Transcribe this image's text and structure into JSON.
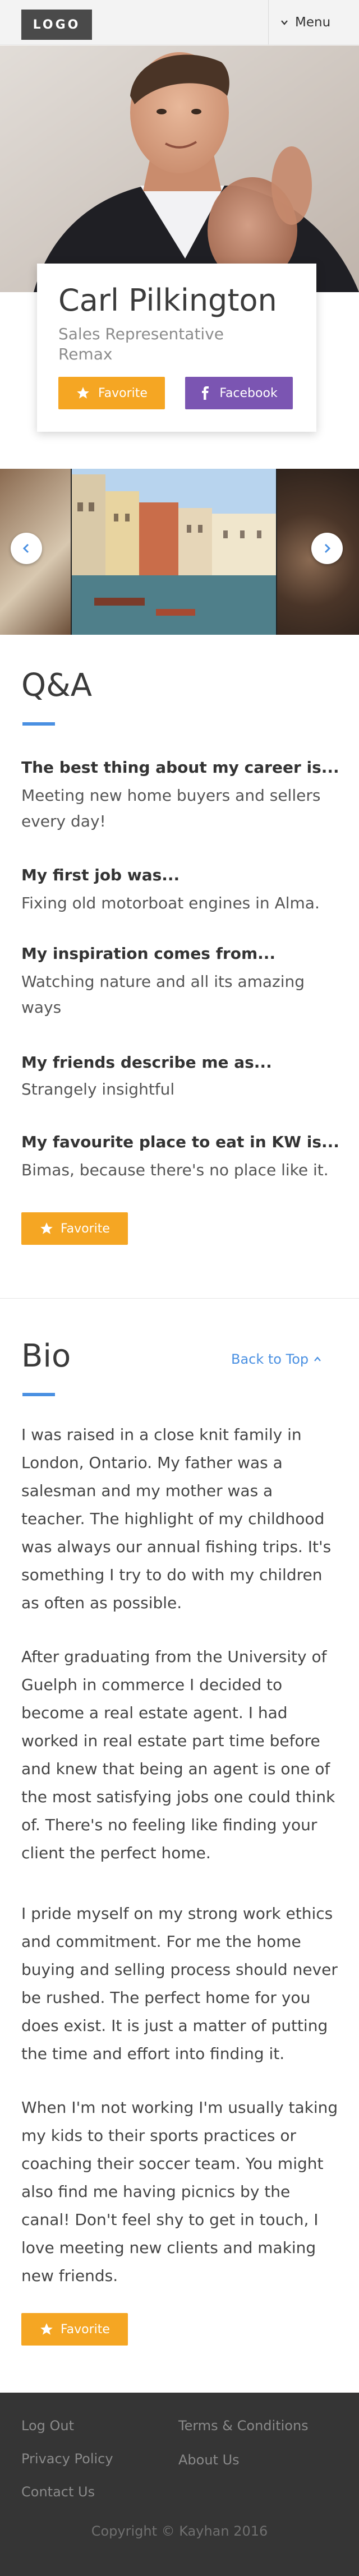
{
  "header": {
    "logo": "LOGO",
    "menu_label": "Menu"
  },
  "profile": {
    "name": "Carl Pilkington",
    "title": "Sales Representative",
    "company": "Remax",
    "favorite_label": "Favorite",
    "facebook_label": "Facebook"
  },
  "gallery": {
    "prev_icon": "chevron-left-icon",
    "next_icon": "chevron-right-icon"
  },
  "qa": {
    "title": "Q&A",
    "items": [
      {
        "question": "The best thing about my career is...",
        "answer": "Meeting new home buyers and sellers every day!"
      },
      {
        "question": "My first job was...",
        "answer": "Fixing old motorboat engines in Alma."
      },
      {
        "question": "My inspiration comes from...",
        "answer": "Watching nature and all its amazing ways"
      },
      {
        "question": "My friends describe me as...",
        "answer": "Strangely insightful"
      },
      {
        "question": "My favourite place to eat in KW is...",
        "answer": "Bimas, because there's no place like it."
      }
    ],
    "favorite_label": "Favorite"
  },
  "bio": {
    "title": "Bio",
    "back_to_top": "Back to Top",
    "paragraphs": [
      "I was raised in a close knit family in London, Ontario. My father was a salesman and my mother was a teacher. The highlight of my childhood was always our annual fishing trips. It's something I try to do with my children as often as possible.",
      "After graduating from the University of Guelph in commerce I decided to become a real estate agent. I had worked in real estate part time before and knew that being an agent is one of the most satisfying jobs one could think of. There's no feeling like finding your client the perfect home.",
      "I pride myself on my strong work ethics and commitment. For me the home buying and selling process should never be rushed. The perfect home for you does exist. It is just a matter of putting the time and effort into finding it.",
      "When I'm not working I'm usually taking my kids to their sports practices or coaching their soccer team. You might also find me having picnics by the canal! Don't feel shy to get in touch, I love meeting new clients and making new friends."
    ],
    "favorite_label": "Favorite"
  },
  "footer": {
    "links_left": [
      "Log Out",
      "Privacy Policy",
      "Contact Us"
    ],
    "links_right": [
      "Terms & Conditions",
      "About Us"
    ],
    "copyright": "Copyright © Kayhan 2016"
  },
  "colors": {
    "accent_orange": "#f5a623",
    "facebook_purple": "#7b55b2",
    "link_blue": "#4a90e2",
    "footer_bg": "#353535"
  }
}
